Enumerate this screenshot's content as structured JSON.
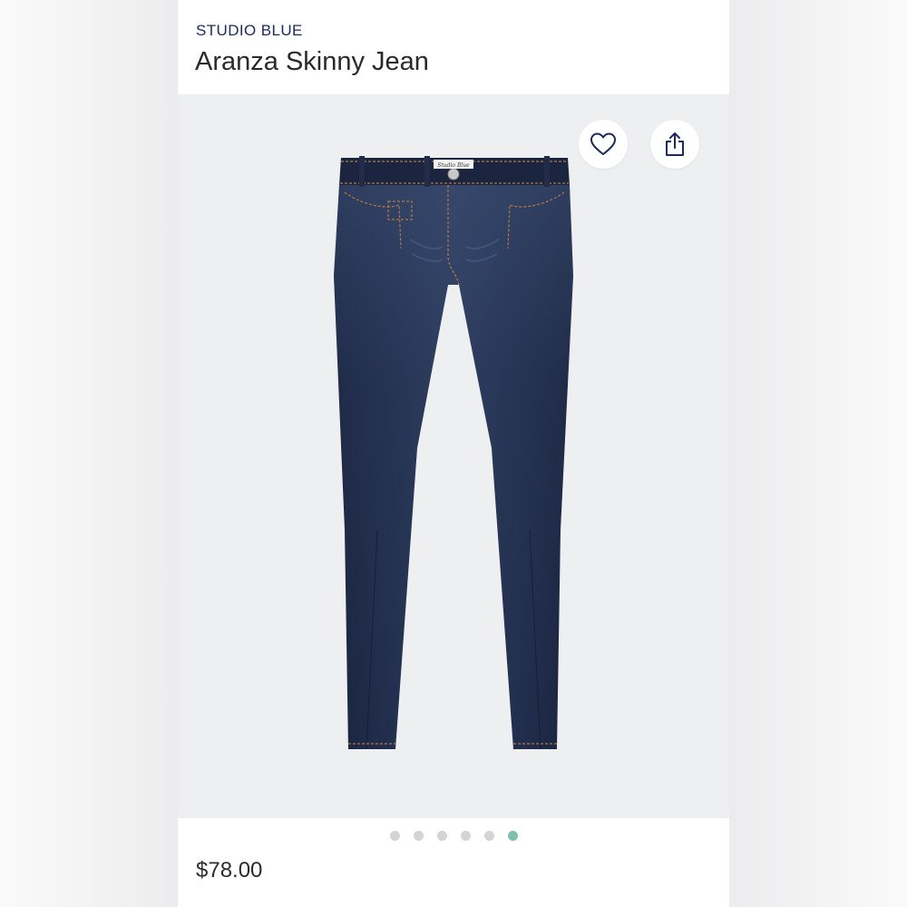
{
  "product": {
    "brand": "STUDIO BLUE",
    "name": "Aranza Skinny Jean",
    "price": "$78.00",
    "label_text": "Studio Blue"
  },
  "actions": {
    "favorite_icon": "heart-icon",
    "share_icon": "share-icon"
  },
  "carousel": {
    "total": 6,
    "active_index": 5
  },
  "colors": {
    "brand": "#1c2b5a",
    "active_dot": "#7fbfae",
    "inactive_dot": "#d3d4d6",
    "denim": "#1f2a44",
    "stitch": "#b27a3e"
  }
}
